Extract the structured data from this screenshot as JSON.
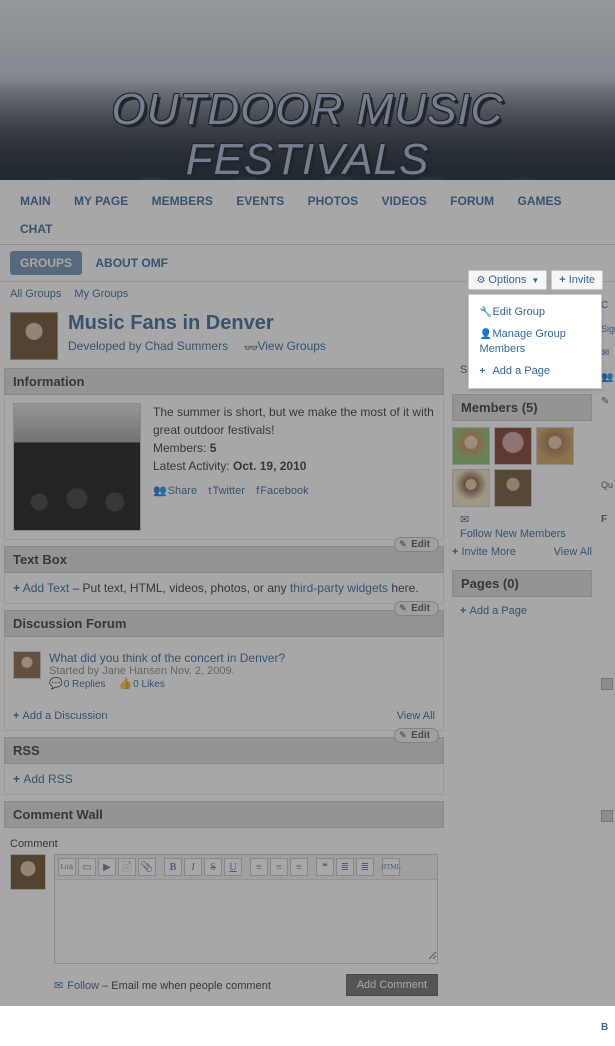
{
  "banner": {
    "title": "OUTDOOR MUSIC FESTIVALS"
  },
  "main_nav": [
    "MAIN",
    "MY PAGE",
    "MEMBERS",
    "EVENTS",
    "PHOTOS",
    "VIDEOS",
    "FORUM",
    "GAMES",
    "CHAT"
  ],
  "sub_nav": {
    "groups": "GROUPS",
    "about": "ABOUT OMF"
  },
  "group_links": {
    "all": "All Groups",
    "my": "My Groups"
  },
  "side_buttons": {
    "options": "Options",
    "invite": "Invite"
  },
  "dropdown": {
    "edit_group": "Edit Group",
    "manage_members": "Manage Group Members",
    "add_page": "Add a Page"
  },
  "group": {
    "title": "Music Fans in Denver",
    "by_prefix": "Developed by ",
    "by_name": "Chad Summers",
    "view_groups": "View Groups"
  },
  "info": {
    "header": "Information",
    "desc": "The summer is short, but we make the most of it with great outdoor festivals!",
    "members_label": "Members: ",
    "members_count": "5",
    "activity_label": "Latest Activity: ",
    "activity_date": "Oct. 19, 2010",
    "share": "Share",
    "twitter": "Twitter",
    "facebook": "Facebook"
  },
  "textbox": {
    "header": "Text Box",
    "edit": "Edit",
    "add_text": "Add Text",
    "instr_mid": " – Put text, HTML, videos, photos, or any ",
    "third_party": "third-party widgets",
    "instr_end": " here."
  },
  "forum": {
    "header": "Discussion Forum",
    "edit": "Edit",
    "topic": "What did you think of the concert in Denver?",
    "started": "Started by Jane Hansen Nov. 2, 2009.",
    "replies": "0 Replies",
    "likes": "0 Likes",
    "add": "Add a Discussion",
    "view_all": "View All"
  },
  "rss": {
    "header": "RSS",
    "edit": "Edit",
    "add": "Add RSS"
  },
  "comment_wall": {
    "header": "Comment Wall",
    "label": "Comment",
    "toolbar": [
      "Link",
      "Img",
      "Vid",
      "File",
      "Att",
      "B",
      "I",
      "S",
      "U",
      "L",
      "C",
      "R",
      "Q",
      "OL",
      "UL",
      "HTML"
    ],
    "follow": "Follow",
    "email_note": " – Email me when people comment",
    "add_btn": "Add Comment"
  },
  "members": {
    "header": "Members (5)",
    "follow_new": "Follow New Members",
    "invite_more": "Invite More",
    "view_all": "View All"
  },
  "pages": {
    "header": "Pages (0)",
    "add": "Add a Page"
  },
  "side_hidden": {
    "send_msg": "Send Message to Group",
    "sign": "Sign",
    "q": "Qu",
    "f": "F",
    "b": "B"
  },
  "edge_letters": [
    "C",
    "✉",
    "👥",
    "✎",
    "",
    "",
    "",
    "",
    "",
    "⬜",
    "",
    "",
    "",
    "",
    "",
    "⬜",
    "",
    "",
    "",
    "",
    "",
    "",
    "",
    "",
    "",
    "",
    "⬜"
  ]
}
